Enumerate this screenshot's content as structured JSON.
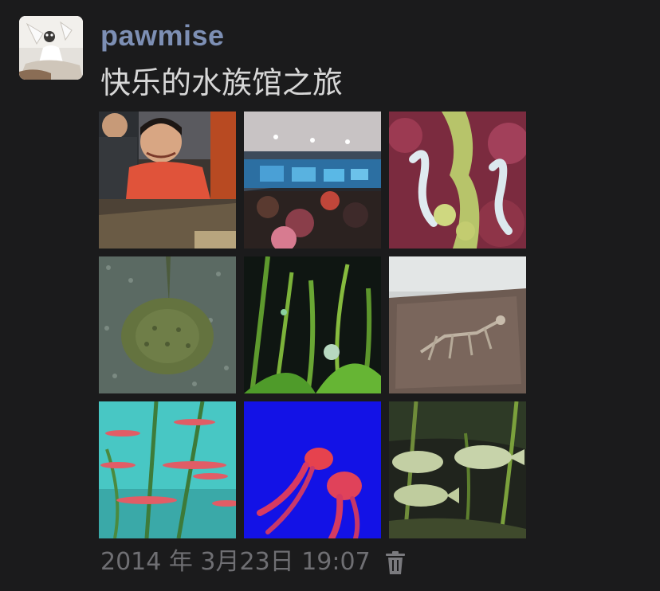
{
  "post": {
    "username": "pawmise",
    "text": "快乐的水族馆之旅",
    "timestamp": "2014 年 3月23日 19:07",
    "avatar_icon": "avatar-photo",
    "delete_icon": "trash-icon",
    "photos": [
      {
        "subject": "smiling girl in red jacket at aquarium"
      },
      {
        "subject": "aquarium hall with visitors"
      },
      {
        "subject": "seahorses among coral"
      },
      {
        "subject": "stingray on gravel"
      },
      {
        "subject": "green aquatic plants"
      },
      {
        "subject": "fossil skeleton in rock"
      },
      {
        "subject": "red fish in teal water"
      },
      {
        "subject": "red jellyfish on blue"
      },
      {
        "subject": "fish among plants"
      }
    ]
  },
  "colors": {
    "background": "#1b1b1c",
    "username": "#7d8fb4",
    "text": "#d7d7d7",
    "timestamp": "#6f6f73"
  }
}
